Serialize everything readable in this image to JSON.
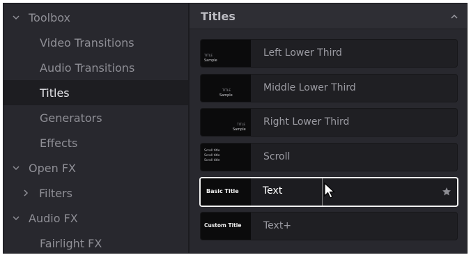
{
  "sidebar": {
    "items": [
      {
        "label": "Toolbox"
      },
      {
        "label": "Video Transitions"
      },
      {
        "label": "Audio Transitions"
      },
      {
        "label": "Titles"
      },
      {
        "label": "Generators"
      },
      {
        "label": "Effects"
      },
      {
        "label": "Open FX"
      },
      {
        "label": "Filters"
      },
      {
        "label": "Audio FX"
      },
      {
        "label": "Fairlight FX"
      }
    ],
    "selected": "Titles"
  },
  "panel": {
    "title": "Titles",
    "tiles": [
      {
        "label": "Left Lower Third",
        "thumb_title": "TITLE",
        "thumb_text": "Sample"
      },
      {
        "label": "Middle Lower Third",
        "thumb_title": "TITLE",
        "thumb_text": "Sample"
      },
      {
        "label": "Right Lower Third",
        "thumb_title": "TITLE",
        "thumb_text": "Sample"
      },
      {
        "label": "Scroll",
        "thumb_lines": [
          "Scroll title",
          "Scroll title",
          "Scroll title"
        ]
      },
      {
        "label": "Text",
        "thumb_text": "Basic Title"
      },
      {
        "label": "Text+",
        "thumb_text": "Custom Title"
      }
    ],
    "selected": "Text"
  },
  "colors": {
    "background": "#28282e",
    "selected_row": "#1d1d21",
    "tile": "#1f1f23",
    "selected_border": "#f2f2f2"
  },
  "icons": {
    "expand": "chevron-down-icon",
    "collapsed": "chevron-right-icon",
    "collapse_panel": "chevron-up-icon",
    "favorite": "star-icon",
    "pointer": "mouse-pointer-icon"
  }
}
